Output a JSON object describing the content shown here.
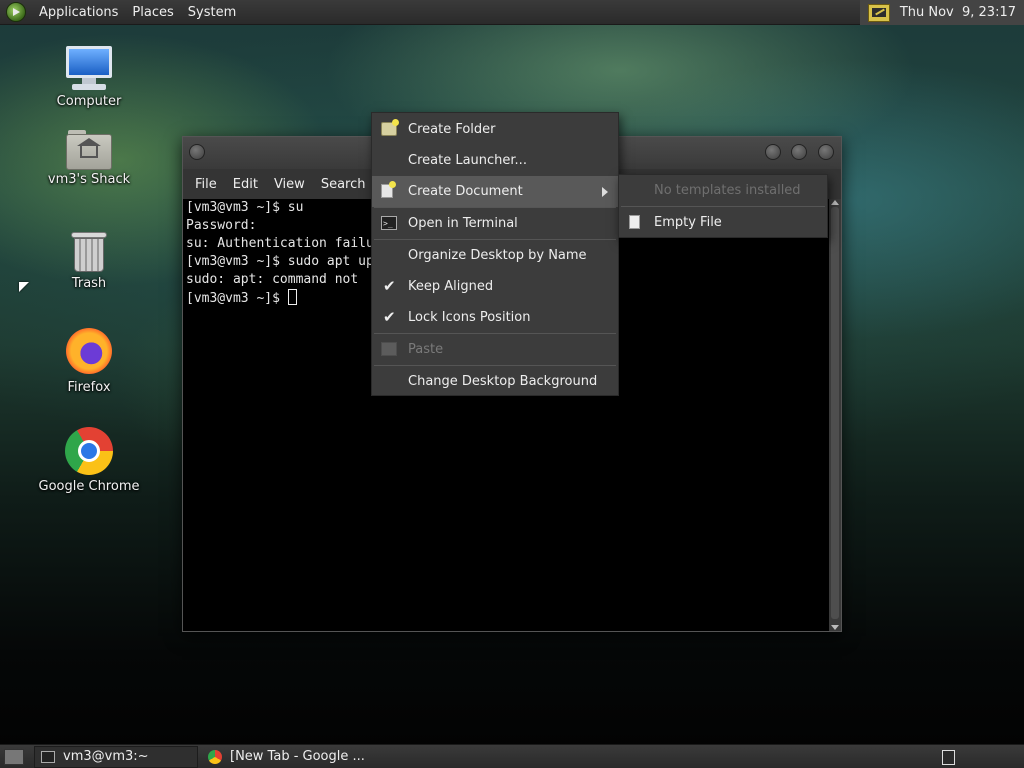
{
  "top_panel": {
    "menus": [
      "Applications",
      "Places",
      "System"
    ],
    "clock": "Thu Nov  9, 23:17"
  },
  "desktop_icons": [
    {
      "label": "Computer",
      "icon": "computer-icon"
    },
    {
      "label": "vm3's Shack",
      "icon": "home-folder-icon"
    },
    {
      "label": "Trash",
      "icon": "trash-icon"
    },
    {
      "label": "Firefox",
      "icon": "firefox-icon"
    },
    {
      "label": "Google Chrome",
      "icon": "chrome-icon"
    }
  ],
  "terminal": {
    "menu": [
      "File",
      "Edit",
      "View",
      "Search"
    ],
    "lines": [
      "[vm3@vm3 ~]$ su",
      "Password:",
      "su: Authentication failu",
      "[vm3@vm3 ~]$ sudo apt up",
      "sudo: apt: command not ",
      "[vm3@vm3 ~]$ "
    ]
  },
  "context_menu": {
    "items": [
      {
        "label": "Create Folder",
        "icon": "new-folder-icon"
      },
      {
        "label": "Create Launcher...",
        "icon": ""
      },
      {
        "label": "Create Document",
        "icon": "new-document-icon",
        "submenu": true,
        "active": true
      },
      {
        "label": "Open in Terminal",
        "icon": "terminal-icon"
      },
      {
        "label": "Organize Desktop by Name",
        "icon": ""
      },
      {
        "label": "Keep Aligned",
        "checked": true
      },
      {
        "label": "Lock Icons Position",
        "checked": true
      },
      {
        "label": "Paste",
        "icon": "paste-icon",
        "disabled": true
      },
      {
        "label": "Change Desktop Background",
        "icon": ""
      }
    ]
  },
  "submenu": {
    "items": [
      {
        "label": "No templates installed",
        "disabled": true
      },
      {
        "label": "Empty File",
        "icon": "file-icon"
      }
    ]
  },
  "taskbar": {
    "tasks": [
      {
        "label": "vm3@vm3:~",
        "icon": "terminal-icon"
      },
      {
        "label": "[New Tab - Google ...",
        "icon": "chrome-icon"
      }
    ]
  },
  "colors": {
    "panel": "#2f2f2f",
    "menu_bg": "#3c3c3c",
    "menu_active": "#595959",
    "terminal_bg": "#000000"
  }
}
